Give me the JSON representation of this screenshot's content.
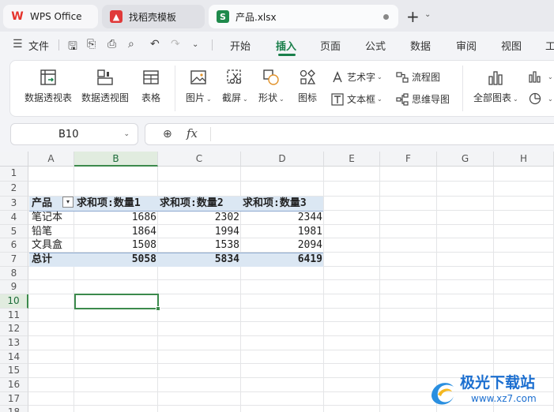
{
  "tabs": [
    {
      "label": "WPS Office",
      "icon": "wps-logo-icon"
    },
    {
      "label": "找稻壳模板",
      "icon": "docer-icon"
    },
    {
      "label": "产品.xlsx",
      "icon": "spreadsheet-icon",
      "icon_letter": "S"
    }
  ],
  "menu": {
    "file": "文件",
    "items": [
      "开始",
      "插入",
      "页面",
      "公式",
      "数据",
      "审阅",
      "视图",
      "工"
    ],
    "active": "插入"
  },
  "ribbon": {
    "pivot_table": "数据透视表",
    "pivot_chart": "数据透视图",
    "table": "表格",
    "picture": "图片",
    "screenshot": "截屏",
    "shape": "形状",
    "icon": "图标",
    "wordart": "艺术字",
    "textbox": "文本框",
    "flowchart": "流程图",
    "mindmap": "思维导图",
    "all_charts": "全部图表"
  },
  "formula_bar": {
    "name_box": "B10",
    "fx": "fx",
    "value": ""
  },
  "columns": [
    "A",
    "B",
    "C",
    "D",
    "E",
    "F",
    "G",
    "H"
  ],
  "rows": [
    "1",
    "2",
    "3",
    "4",
    "5",
    "6",
    "7",
    "8",
    "9",
    "10",
    "11",
    "12",
    "13",
    "14",
    "15",
    "16",
    "17",
    "18"
  ],
  "selected_cell": {
    "column": "B",
    "row": "10"
  },
  "pivot": {
    "header": [
      "产品",
      "求和项:数量1",
      "求和项:数量2",
      "求和项:数量3"
    ],
    "rows": [
      {
        "product": "笔记本",
        "q1": "1686",
        "q2": "2302",
        "q3": "2344"
      },
      {
        "product": "铅笔",
        "q1": "1864",
        "q2": "1994",
        "q3": "1981"
      },
      {
        "product": "文具盒",
        "q1": "1508",
        "q2": "1538",
        "q3": "2094"
      }
    ],
    "total": {
      "label": "总计",
      "q1": "5058",
      "q2": "5834",
      "q3": "6419"
    }
  },
  "watermark": {
    "title": "极光下载站",
    "url": "www.xz7.com"
  },
  "colors": {
    "accent": "#1a7f4b",
    "pivot_band": "#dbe7f3",
    "selection": "#3c8a4c"
  }
}
